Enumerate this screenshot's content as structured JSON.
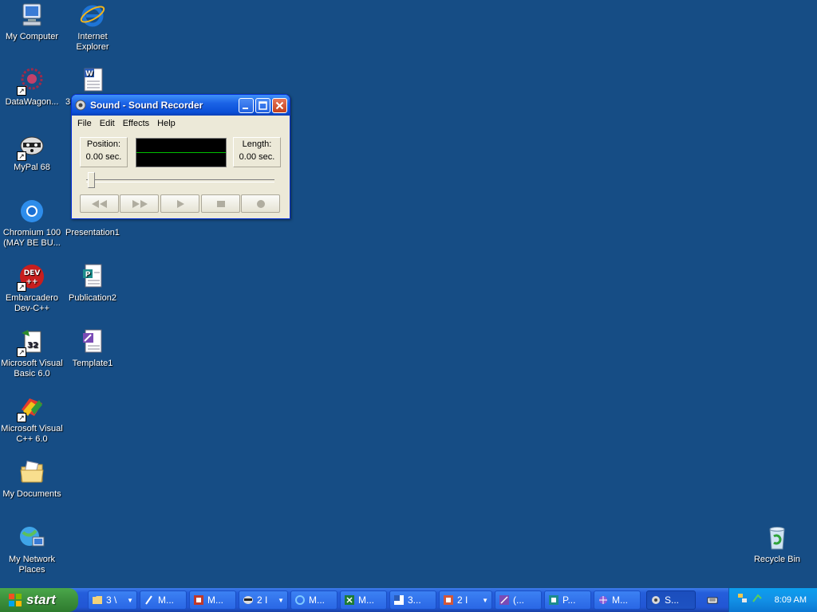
{
  "desktop": {
    "icons": [
      {
        "label": "My Computer"
      },
      {
        "label": "Internet\nExplorer"
      },
      {
        "label": "DataWagon..."
      },
      {
        "label": "3"
      },
      {
        "label": "MyPal 68"
      },
      {
        "label": "Chromium 100\n(MAY BE BU..."
      },
      {
        "label": "Presentation1"
      },
      {
        "label": "Embarcadero\nDev-C++"
      },
      {
        "label": "Publication2"
      },
      {
        "label": "Microsoft Visual\nBasic 6.0"
      },
      {
        "label": "Template1"
      },
      {
        "label": "Microsoft Visual\nC++ 6.0"
      },
      {
        "label": "My Documents"
      },
      {
        "label": "My Network\nPlaces"
      },
      {
        "label": "Recycle Bin"
      }
    ]
  },
  "window": {
    "title": "Sound - Sound Recorder",
    "menu": [
      "File",
      "Edit",
      "Effects",
      "Help"
    ],
    "position_label": "Position:",
    "position_value": "0.00 sec.",
    "length_label": "Length:",
    "length_value": "0.00 sec.",
    "slider_position": 0,
    "controls": [
      "rewind-icon",
      "fast-forward-icon",
      "play-icon",
      "stop-icon",
      "record-icon"
    ]
  },
  "taskbar": {
    "start_label": "start",
    "buttons": [
      {
        "label": "3 \\",
        "icon": "folder-icon",
        "group": true
      },
      {
        "label": "M...",
        "icon": "paint-icon",
        "group": false
      },
      {
        "label": "M...",
        "icon": "access-icon",
        "group": false
      },
      {
        "label": "2 I",
        "icon": "mypal-icon",
        "group": true
      },
      {
        "label": "M...",
        "icon": "ie-icon",
        "group": false
      },
      {
        "label": "M...",
        "icon": "excel-icon",
        "group": false
      },
      {
        "label": "3...",
        "icon": "word-icon",
        "group": false
      },
      {
        "label": "2 I",
        "icon": "powerpoint-icon",
        "group": true
      },
      {
        "label": "(...",
        "icon": "template-icon",
        "group": false
      },
      {
        "label": "P...",
        "icon": "publisher-icon",
        "group": false
      },
      {
        "label": "M...",
        "icon": "vc-icon",
        "group": false
      },
      {
        "label": "S...",
        "icon": "sound-recorder-icon",
        "group": false,
        "active": true
      }
    ],
    "clock": "8:09 AM"
  },
  "colors": {
    "desktop_bg": "#164D85",
    "titlebar": "#0A4FD6",
    "taskbar": "#245EDB",
    "start_green": "#3C8F3C"
  }
}
